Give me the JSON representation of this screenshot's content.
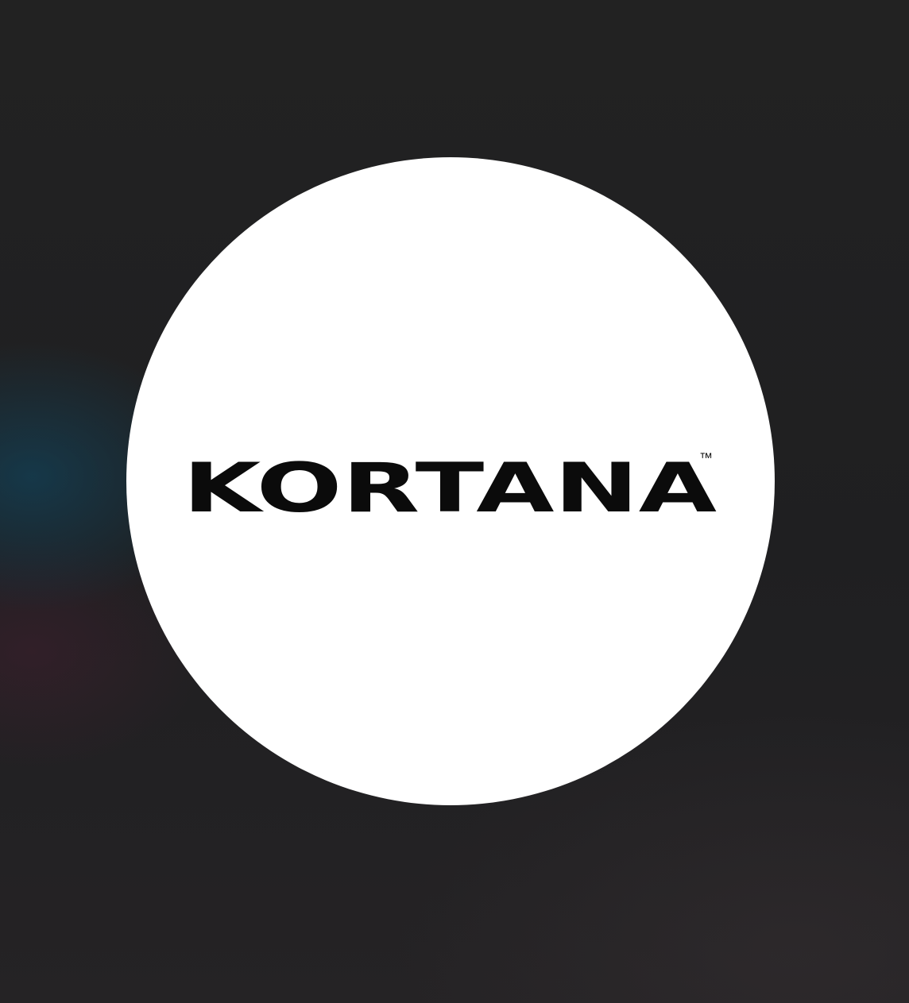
{
  "logo": {
    "wordmark": "KORTANA",
    "trademark": "™"
  },
  "colors": {
    "background": "#212123",
    "circle": "#ffffff",
    "text": "#0b0b0b",
    "teal_glow": "#124056",
    "maroon_glow": "#461e30"
  }
}
